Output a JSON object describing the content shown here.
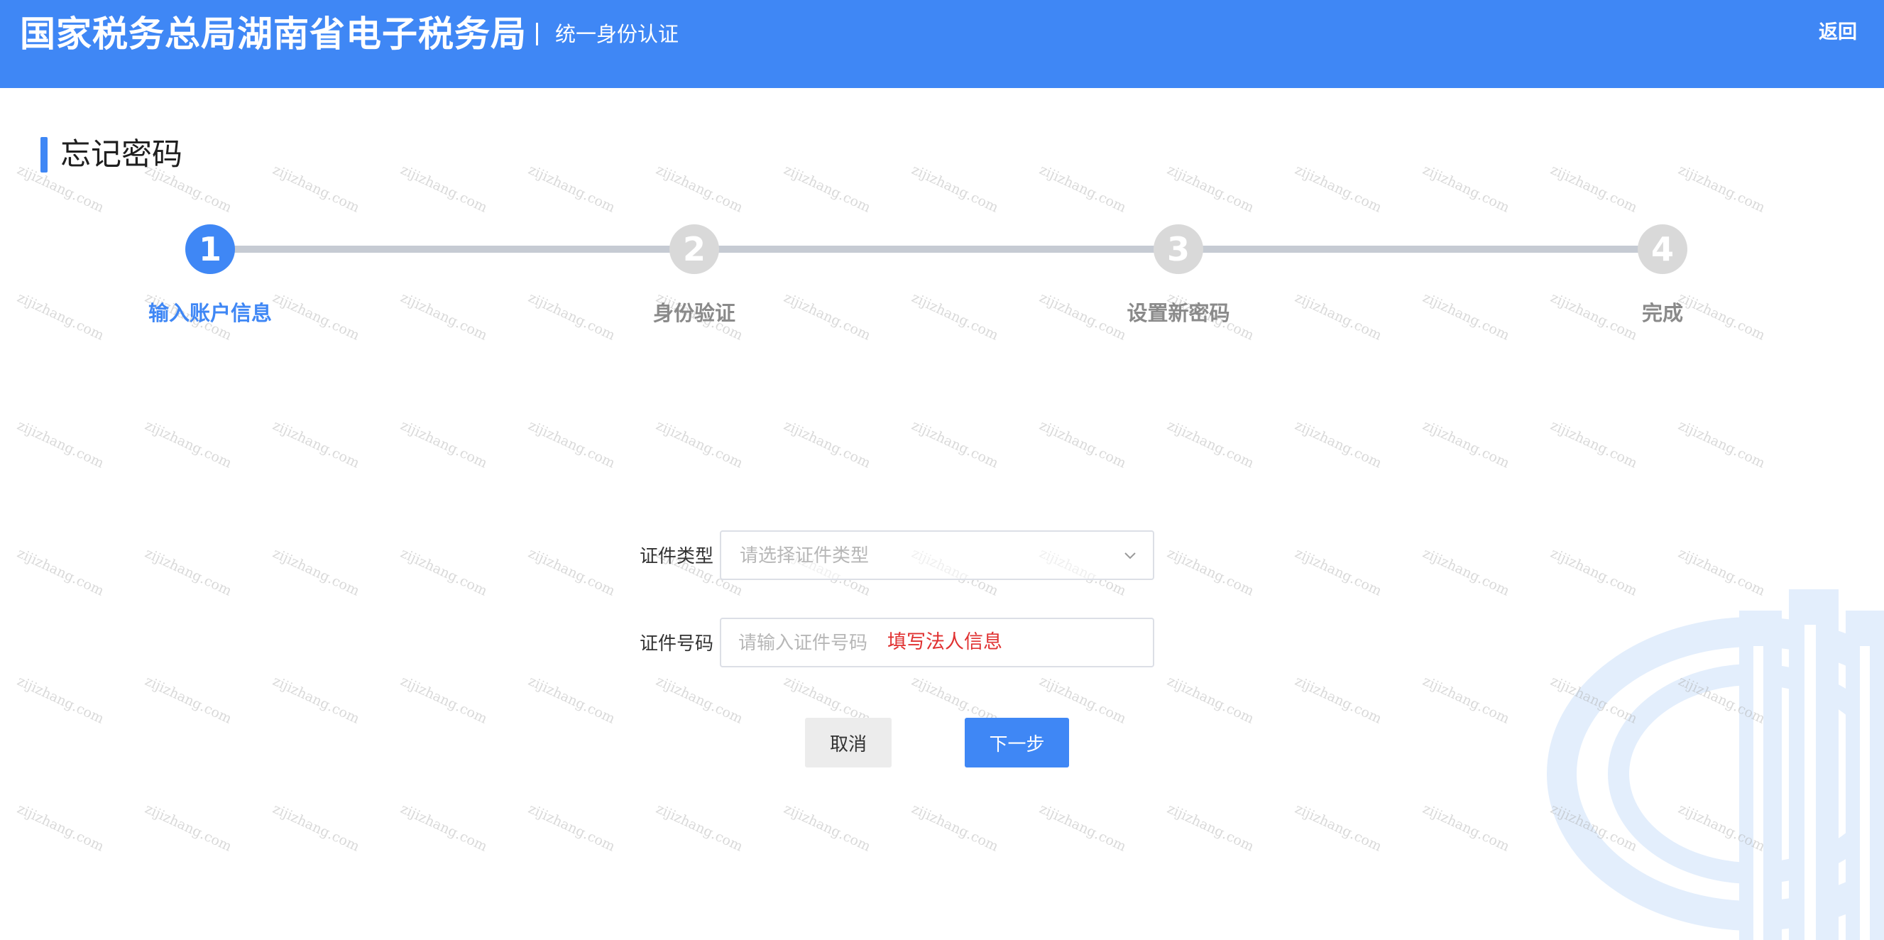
{
  "header": {
    "title": "国家税务总局湖南省电子税务局",
    "subtitle": "统一身份认证",
    "back_label": "返回"
  },
  "page": {
    "title": "忘记密码"
  },
  "steps": [
    {
      "number": "1",
      "label": "输入账户信息",
      "active": true
    },
    {
      "number": "2",
      "label": "身份验证",
      "active": false
    },
    {
      "number": "3",
      "label": "设置新密码",
      "active": false
    },
    {
      "number": "4",
      "label": "完成",
      "active": false
    }
  ],
  "form": {
    "cert_type": {
      "label": "证件类型",
      "placeholder": "请选择证件类型",
      "value": ""
    },
    "cert_number": {
      "label": "证件号码",
      "placeholder": "请输入证件号码",
      "value": "",
      "hint": "填写法人信息"
    }
  },
  "buttons": {
    "cancel": "取消",
    "next": "下一步"
  },
  "watermark_text": "zijizhang.com",
  "colors": {
    "primary": "#3f87f5",
    "step_inactive": "#d9d9d9",
    "hint_red": "#e03131"
  },
  "icons": {
    "select_chevron": "chevron-down-icon",
    "background_emblem": "tax-emblem-icon"
  }
}
